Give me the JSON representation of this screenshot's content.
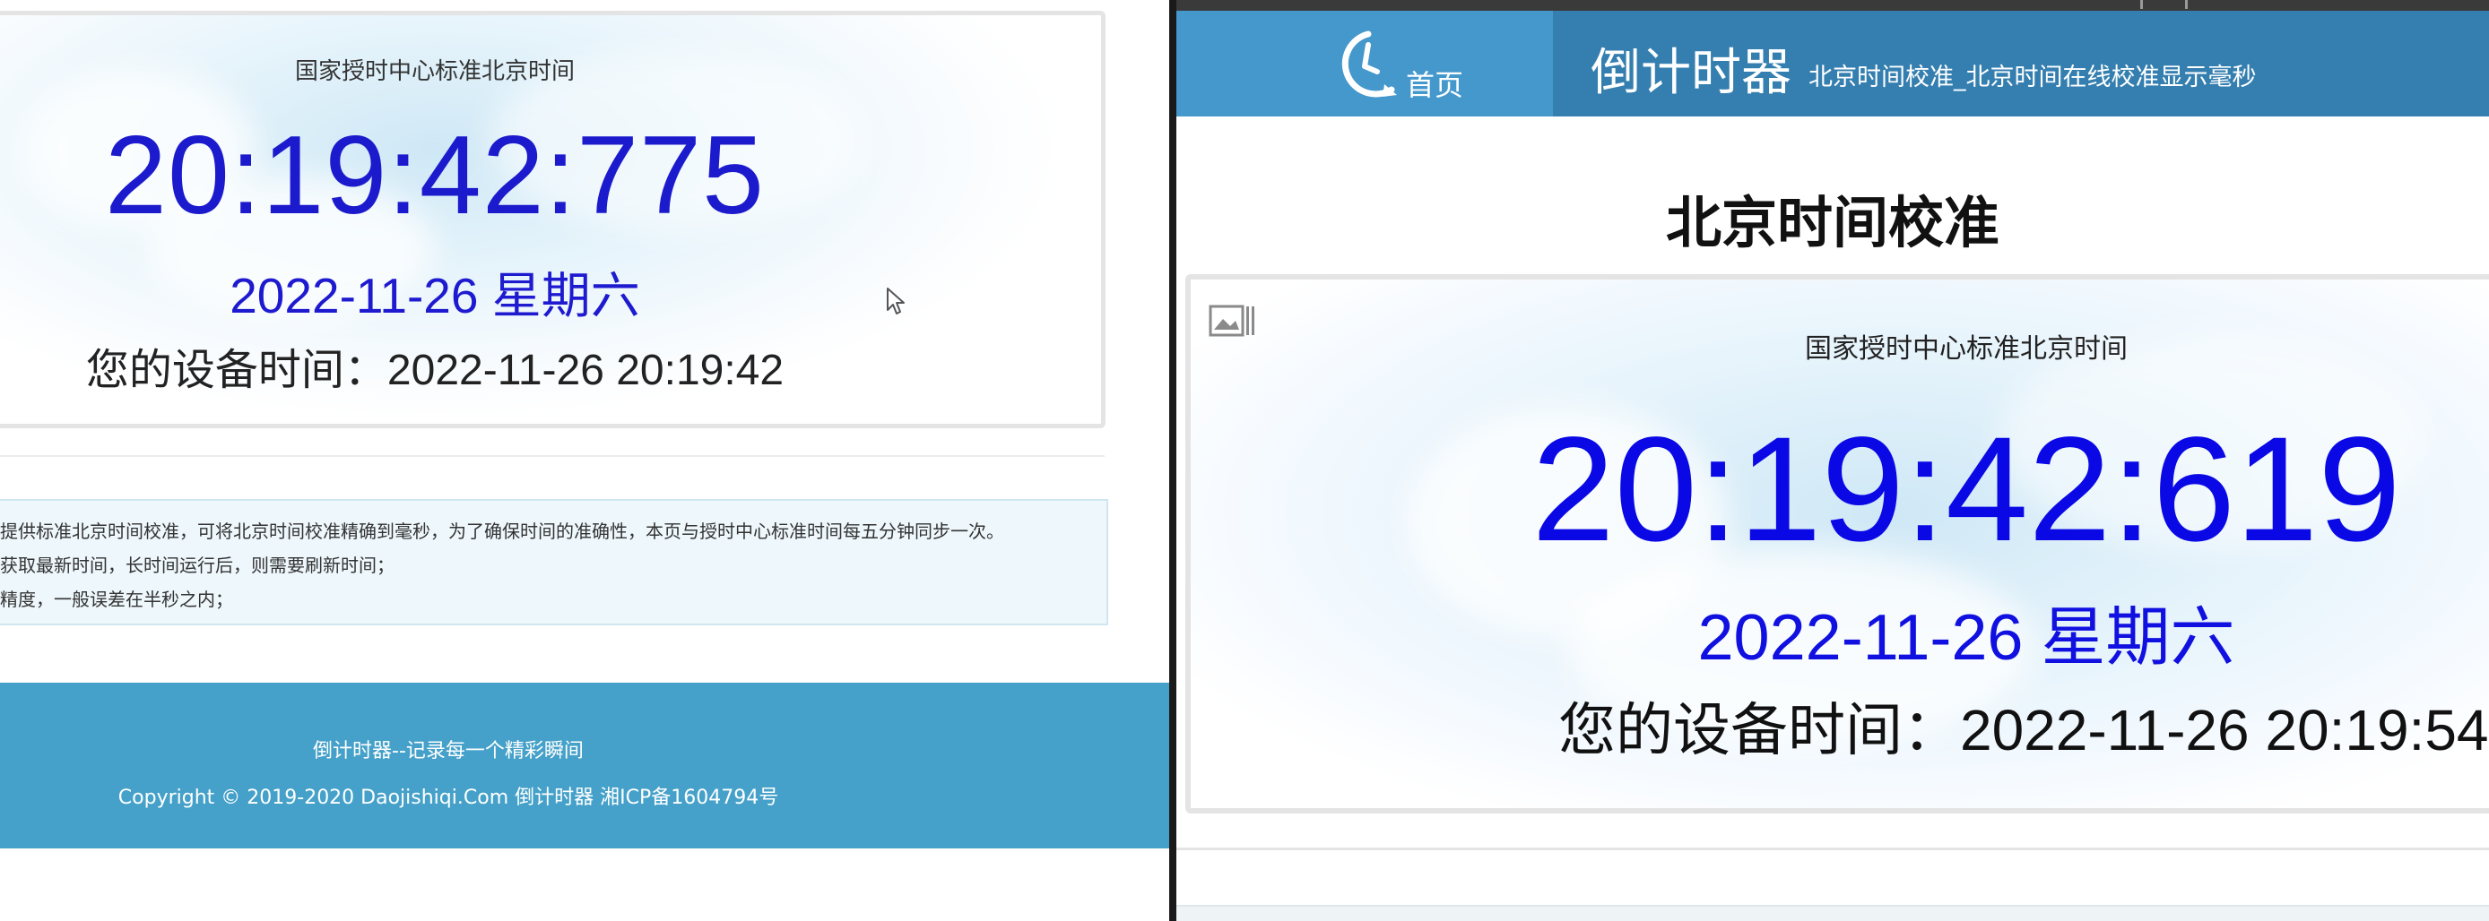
{
  "left_window": {
    "subtitle": "国家授时中心标准北京时间",
    "clock": "20:19:42:775",
    "date": "2022-11-26 星期六",
    "device_time": "您的设备时间：2022-11-26 20:19:42",
    "notes": [
      "提供标准北京时间校准，可将北京时间校准精确到毫秒，为了确保时间的准确性，本页与授时中心标准时间每五分钟同步一次。",
      "获取最新时间，长时间运行后，则需要刷新时间；",
      "精度，一般误差在半秒之内；"
    ],
    "footer": {
      "tagline": "倒计时器--记录每一个精彩瞬间",
      "copyright": "Copyright © 2019-2020  Daojishiqi.Com  倒计时器  湘ICP备1604794号"
    }
  },
  "right_window": {
    "nav": {
      "home_label": "首页",
      "brand": "倒计时器",
      "slogan": "北京时间校准_北京时间在线校准显示毫秒"
    },
    "page_title": "北京时间校准",
    "subtitle": "国家授时中心标准北京时间",
    "clock": "20:19:42:619",
    "date": "2022-11-26 星期六",
    "device_time": "您的设备时间：2022-11-26 20:19:54"
  },
  "colors": {
    "clock_blue": "#0a09e6",
    "nav_blue": "#357fb0",
    "footer_blue": "#45a1c9"
  },
  "icons": [
    "clock-icon",
    "image-icon",
    "mouse-cursor-icon"
  ]
}
